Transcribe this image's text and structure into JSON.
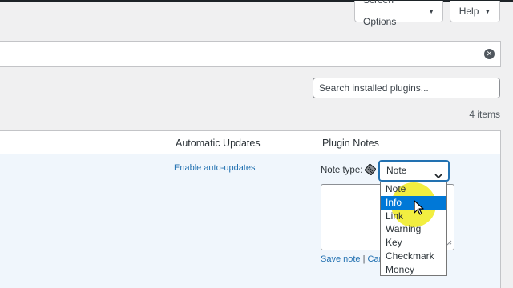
{
  "header": {
    "screen_options_label": "Screen Options",
    "help_label": "Help",
    "caret_glyph": "▼"
  },
  "notice": {
    "dismiss_icon": "dismiss-icon"
  },
  "search": {
    "placeholder": "Search installed plugins..."
  },
  "items_count": "4 items",
  "table": {
    "columns": [
      "Automatic Updates",
      "Plugin Notes"
    ]
  },
  "row": {
    "auto_updates_link": "Enable auto-updates",
    "note_type_label": "Note type:",
    "note_type_icon": "note-icon",
    "selected_type": "Note",
    "save_label": "Save note",
    "separator": "|",
    "cancel_label": "Can"
  },
  "dropdown": {
    "options": [
      "Note",
      "Info",
      "Link",
      "Warning",
      "Key",
      "Checkmark",
      "Money"
    ],
    "highlighted_index": 1
  },
  "colors": {
    "accent": "#2271b1",
    "option_highlight": "#0078d7",
    "row_background": "#f0f6fc",
    "cursor_highlight": "#f0eb1e"
  }
}
